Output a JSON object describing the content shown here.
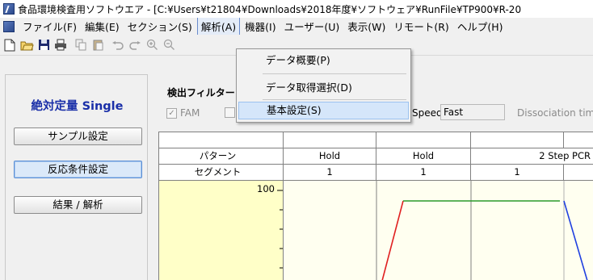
{
  "window": {
    "title": "食品環境検査用ソフトウエア - [C:¥Users¥t21804¥Downloads¥2018年度¥ソフトウェア¥RunFile¥TP900¥R-20"
  },
  "menubar": {
    "items": [
      "ファイル(F)",
      "編集(E)",
      "セクション(S)",
      "解析(A)",
      "機器(I)",
      "ユーザー(U)",
      "表示(W)",
      "リモート(R)",
      "ヘルプ(H)"
    ],
    "active_index": 3
  },
  "toolbar": {
    "icons": [
      "new-file-icon",
      "open-folder-icon",
      "save-icon",
      "print-icon",
      "copy-icon",
      "paste-icon",
      "undo-icon",
      "redo-icon",
      "zoom-in-icon",
      "zoom-out-icon"
    ]
  },
  "dropdown": {
    "items": [
      "データ概要(P)",
      "データ取得選択(D)",
      "基本設定(S)"
    ],
    "highlight_index": 2
  },
  "left_panel": {
    "mode_title": "絶対定量 Single",
    "buttons": [
      "サンプル設定",
      "反応条件設定",
      "結果 / 解析"
    ],
    "active_index": 1
  },
  "filter": {
    "label": "検出フィルター",
    "fam_label": "FAM",
    "fam_checked": true,
    "speed_label": "Speed",
    "speed_value": "Fast",
    "dissociation_label": "Dissociation tim"
  },
  "grid": {
    "pattern_label": "パターン",
    "segment_label": "セグメント",
    "patterns": [
      "Hold",
      "Hold",
      "2 Step PCR"
    ],
    "segments": [
      "1",
      "1",
      "1"
    ],
    "y_max_label": "100"
  },
  "colors": {
    "accent_blue": "#1a2fa8",
    "plot_red": "#e02020",
    "plot_green": "#2a9a2a",
    "plot_blue": "#2040e0",
    "plot_bg": "#ffffc8"
  }
}
